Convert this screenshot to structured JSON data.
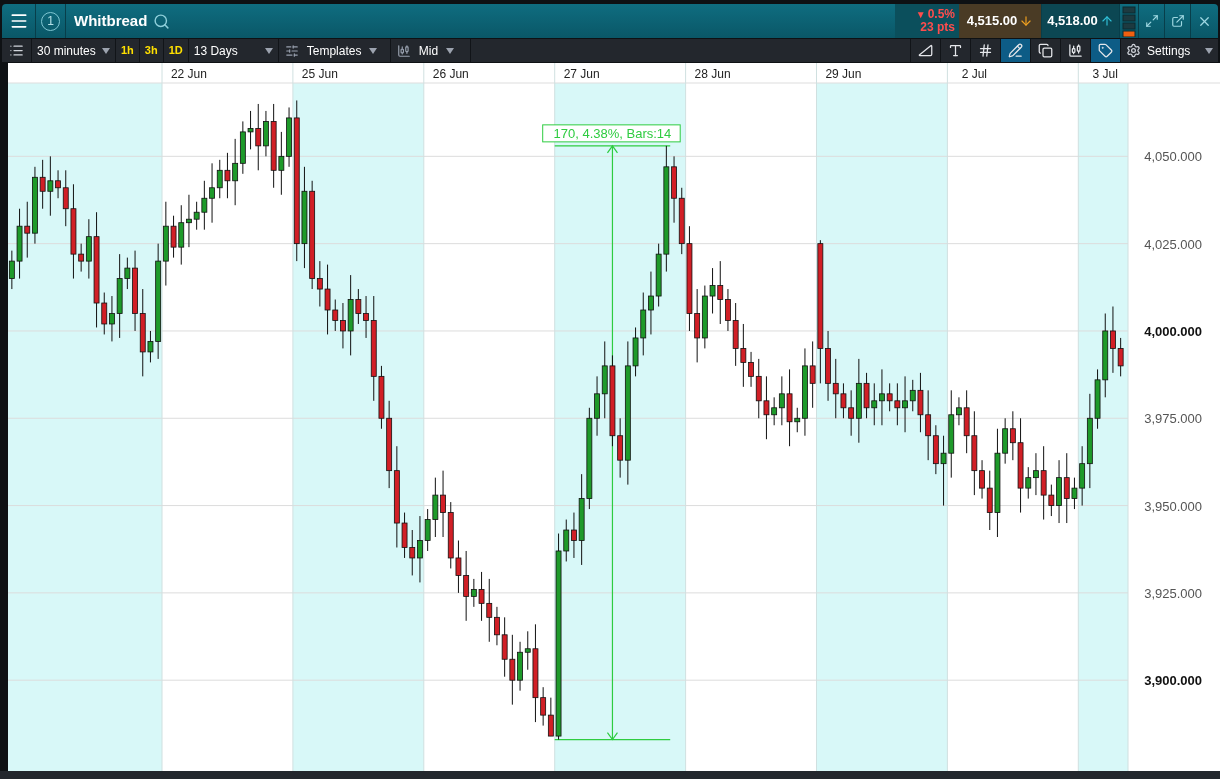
{
  "header": {
    "panel_number": "1",
    "title": "Whitbread",
    "change": {
      "arrow": "▼",
      "percent": "0.5%",
      "points": "23 pts"
    },
    "sell": {
      "price": "4,515.00"
    },
    "buy": {
      "price": "4,518.00"
    }
  },
  "toolbar": {
    "interval": "30 minutes",
    "quick_intervals": [
      "1h",
      "3h",
      "1D"
    ],
    "range": "13 Days",
    "templates": "Templates",
    "price_type": "Mid",
    "tools": [
      {
        "kind": "shade",
        "selected": false
      },
      {
        "kind": "text",
        "selected": false
      },
      {
        "kind": "grid",
        "selected": false
      },
      {
        "kind": "draw",
        "selected": true
      },
      {
        "kind": "layers",
        "selected": false
      },
      {
        "kind": "marker",
        "selected": false
      },
      {
        "kind": "label",
        "selected": true
      }
    ],
    "settings": "Settings"
  },
  "chart": {
    "chart_data": {
      "type": "candlestick",
      "grid": true,
      "ylim": [
        3874,
        4071
      ],
      "categories": [
        null,
        null,
        null,
        null,
        null,
        null,
        null,
        null,
        null,
        null,
        null,
        null,
        null,
        null,
        null,
        null,
        null,
        null,
        null,
        null,
        null,
        null,
        null,
        "22 Jun",
        null,
        null,
        null,
        null,
        null,
        null,
        null,
        null,
        null,
        null,
        null,
        null,
        null,
        null,
        null,
        null,
        "25 Jun",
        null,
        null,
        null,
        null,
        null,
        null,
        null,
        null,
        null,
        null,
        null,
        null,
        null,
        null,
        null,
        null,
        "26 Jun",
        null,
        null,
        null,
        null,
        null,
        null,
        null,
        null,
        null,
        null,
        null,
        null,
        null,
        null,
        null,
        null,
        "27 Jun",
        null,
        null,
        null,
        null,
        null,
        null,
        null,
        null,
        null,
        null,
        null,
        null,
        null,
        null,
        null,
        null,
        "28 Jun",
        null,
        null,
        null,
        null,
        null,
        null,
        null,
        null,
        null,
        null,
        null,
        null,
        null,
        null,
        null,
        null,
        "29 Jun",
        null,
        null,
        null,
        null,
        null,
        null,
        null,
        null,
        null,
        null,
        null,
        null,
        null,
        null,
        null,
        null,
        "2 Jul",
        null,
        null,
        null,
        null,
        null,
        null,
        null,
        null,
        null,
        null,
        null,
        null,
        null,
        null,
        null,
        null,
        "3 Jul",
        null,
        null
      ],
      "yticks": [
        {
          "value": 3900,
          "label": "3,900.000"
        },
        {
          "value": 3925,
          "label": "3,925.000"
        },
        {
          "value": 3950,
          "label": "3,950.000"
        },
        {
          "value": 3975,
          "label": "3,975.000"
        },
        {
          "value": 4000,
          "label": "4,000.000"
        },
        {
          "value": 4025,
          "label": "4,025.000"
        },
        {
          "value": 4050,
          "label": "4,050.000"
        }
      ],
      "ohlc": [
        [
          4015,
          4023,
          4012,
          4020
        ],
        [
          4020,
          4035,
          4015,
          4030
        ],
        [
          4030,
          4037,
          4021,
          4028
        ],
        [
          4028,
          4047,
          4025,
          4044
        ],
        [
          4044,
          4049,
          4035,
          4040
        ],
        [
          4040,
          4050,
          4033,
          4043
        ],
        [
          4043,
          4046,
          4038,
          4041
        ],
        [
          4041,
          4046,
          4030,
          4035
        ],
        [
          4035,
          4042,
          4015,
          4022
        ],
        [
          4022,
          4025,
          4017,
          4020
        ],
        [
          4020,
          4032,
          4015,
          4027
        ],
        [
          4027,
          4034,
          4001,
          4008
        ],
        [
          4008,
          4011,
          3999,
          4002
        ],
        [
          4002,
          4010,
          3997,
          4005
        ],
        [
          4005,
          4022,
          3998,
          4015
        ],
        [
          4015,
          4021,
          4012,
          4018
        ],
        [
          4018,
          4023,
          4000,
          4005
        ],
        [
          4005,
          4012,
          3987,
          3994
        ],
        [
          3994,
          4000,
          3991,
          3997
        ],
        [
          3997,
          4025,
          3992,
          4020
        ],
        [
          4020,
          4037,
          4013,
          4030
        ],
        [
          4030,
          4033,
          4021,
          4024
        ],
        [
          4024,
          4036,
          4019,
          4031
        ],
        [
          4031,
          4039,
          4024,
          4032
        ],
        [
          4032,
          4037,
          4029,
          4034
        ],
        [
          4034,
          4043,
          4029,
          4038
        ],
        [
          4038,
          4048,
          4031,
          4041
        ],
        [
          4041,
          4049,
          4038,
          4046
        ],
        [
          4046,
          4051,
          4038,
          4043
        ],
        [
          4043,
          4055,
          4036,
          4048
        ],
        [
          4048,
          4060,
          4045,
          4057
        ],
        [
          4057,
          4063,
          4052,
          4058
        ],
        [
          4058,
          4065,
          4046,
          4053
        ],
        [
          4053,
          4063,
          4050,
          4060
        ],
        [
          4060,
          4065,
          4041,
          4046
        ],
        [
          4046,
          4057,
          4039,
          4050
        ],
        [
          4050,
          4064,
          4047,
          4061
        ],
        [
          4061,
          4066,
          4020,
          4025
        ],
        [
          4025,
          4047,
          4018,
          4040
        ],
        [
          4040,
          4043,
          4012,
          4015
        ],
        [
          4015,
          4020,
          4007,
          4012
        ],
        [
          4012,
          4019,
          3999,
          4006
        ],
        [
          4006,
          4009,
          4000,
          4003
        ],
        [
          4003,
          4008,
          3995,
          4000
        ],
        [
          4000,
          4016,
          3993,
          4009
        ],
        [
          4009,
          4012,
          4002,
          4005
        ],
        [
          4005,
          4010,
          3998,
          4003
        ],
        [
          4003,
          4010,
          3980,
          3987
        ],
        [
          3987,
          3990,
          3972,
          3975
        ],
        [
          3975,
          3980,
          3955,
          3960
        ],
        [
          3960,
          3967,
          3938,
          3945
        ],
        [
          3945,
          3948,
          3935,
          3938
        ],
        [
          3938,
          3943,
          3930,
          3935
        ],
        [
          3935,
          3947,
          3928,
          3940
        ],
        [
          3940,
          3949,
          3937,
          3946
        ],
        [
          3946,
          3958,
          3941,
          3953
        ],
        [
          3953,
          3960,
          3941,
          3948
        ],
        [
          3948,
          3951,
          3932,
          3935
        ],
        [
          3935,
          3940,
          3925,
          3930
        ],
        [
          3930,
          3937,
          3917,
          3924
        ],
        [
          3924,
          3929,
          3921,
          3926
        ],
        [
          3926,
          3931,
          3917,
          3922
        ],
        [
          3922,
          3929,
          3911,
          3918
        ],
        [
          3918,
          3921,
          3910,
          3913
        ],
        [
          3913,
          3918,
          3901,
          3906
        ],
        [
          3906,
          3913,
          3893,
          3900
        ],
        [
          3900,
          3911,
          3897,
          3908
        ],
        [
          3908,
          3914,
          3903,
          3909
        ],
        [
          3909,
          3916,
          3888,
          3895
        ],
        [
          3895,
          3898,
          3887,
          3890
        ],
        [
          3890,
          3895,
          3884,
          3884
        ],
        [
          3884,
          3942,
          3883,
          3937
        ],
        [
          3937,
          3946,
          3934,
          3943
        ],
        [
          3943,
          3948,
          3935,
          3940
        ],
        [
          3940,
          3959,
          3933,
          3952
        ],
        [
          3952,
          3978,
          3949,
          3975
        ],
        [
          3975,
          3987,
          3970,
          3982
        ],
        [
          3982,
          3997,
          3975,
          3990
        ],
        [
          3990,
          3993,
          3967,
          3970
        ],
        [
          3970,
          3975,
          3958,
          3963
        ],
        [
          3963,
          3997,
          3956,
          3990
        ],
        [
          3990,
          4001,
          3987,
          3998
        ],
        [
          3998,
          4011,
          3993,
          4006
        ],
        [
          4006,
          4017,
          3999,
          4010
        ],
        [
          4010,
          4025,
          4007,
          4022
        ],
        [
          4022,
          4053,
          4017,
          4047
        ],
        [
          4047,
          4050,
          4031,
          4038
        ],
        [
          4038,
          4041,
          4022,
          4025
        ],
        [
          4025,
          4030,
          4000,
          4005
        ],
        [
          4005,
          4012,
          3991,
          3998
        ],
        [
          3998,
          4013,
          3995,
          4010
        ],
        [
          4010,
          4018,
          4005,
          4013
        ],
        [
          4013,
          4020,
          4002,
          4009
        ],
        [
          4009,
          4012,
          4000,
          4003
        ],
        [
          4003,
          4008,
          3990,
          3995
        ],
        [
          3995,
          4002,
          3984,
          3991
        ],
        [
          3991,
          3994,
          3984,
          3987
        ],
        [
          3987,
          3992,
          3975,
          3980
        ],
        [
          3980,
          3987,
          3969,
          3976
        ],
        [
          3976,
          3981,
          3973,
          3978
        ],
        [
          3978,
          3987,
          3973,
          3982
        ],
        [
          3982,
          3989,
          3967,
          3974
        ],
        [
          3974,
          3978,
          3971,
          3975
        ],
        [
          3975,
          3995,
          3970,
          3990
        ],
        [
          3990,
          3997,
          3978,
          3985
        ],
        [
          4025,
          4026,
          3985,
          3995
        ],
        [
          3995,
          4000,
          3980,
          3985
        ],
        [
          3985,
          3992,
          3975,
          3982
        ],
        [
          3982,
          3985,
          3975,
          3978
        ],
        [
          3978,
          3983,
          3970,
          3975
        ],
        [
          3975,
          3992,
          3968,
          3985
        ],
        [
          3985,
          3988,
          3975,
          3978
        ],
        [
          3978,
          3985,
          3973,
          3980
        ],
        [
          3980,
          3989,
          3973,
          3982
        ],
        [
          3982,
          3985,
          3977,
          3980
        ],
        [
          3980,
          3985,
          3973,
          3978
        ],
        [
          3978,
          3987,
          3971,
          3980
        ],
        [
          3980,
          3986,
          3977,
          3983
        ],
        [
          3983,
          3988,
          3971,
          3976
        ],
        [
          3976,
          3983,
          3963,
          3970
        ],
        [
          3970,
          3973,
          3959,
          3962
        ],
        [
          3962,
          3970,
          3950,
          3965
        ],
        [
          3965,
          3983,
          3958,
          3976
        ],
        [
          3976,
          3981,
          3973,
          3978
        ],
        [
          3978,
          3983,
          3965,
          3970
        ],
        [
          3970,
          3977,
          3953,
          3960
        ],
        [
          3960,
          3963,
          3952,
          3955
        ],
        [
          3955,
          3960,
          3943,
          3948
        ],
        [
          3948,
          3972,
          3941,
          3965
        ],
        [
          3965,
          3975,
          3962,
          3972
        ],
        [
          3972,
          3977,
          3963,
          3968
        ],
        [
          3968,
          3975,
          3948,
          3955
        ],
        [
          3955,
          3961,
          3952,
          3958
        ],
        [
          3958,
          3965,
          3953,
          3960
        ],
        [
          3960,
          3967,
          3946,
          3953
        ],
        [
          3953,
          3956,
          3947,
          3950
        ],
        [
          3950,
          3963,
          3945,
          3958
        ],
        [
          3958,
          3965,
          3945,
          3952
        ],
        [
          3952,
          3958,
          3949,
          3955
        ],
        [
          3955,
          3967,
          3950,
          3962
        ],
        [
          3962,
          3982,
          3955,
          3975
        ],
        [
          3975,
          3989,
          3972,
          3986
        ],
        [
          3986,
          4005,
          3981,
          4000
        ],
        [
          4000,
          4007,
          3988,
          3995
        ],
        [
          3995,
          3998,
          3987,
          3990
        ]
      ],
      "annotations": [
        "170, 4.38%, Bars:14"
      ]
    }
  }
}
